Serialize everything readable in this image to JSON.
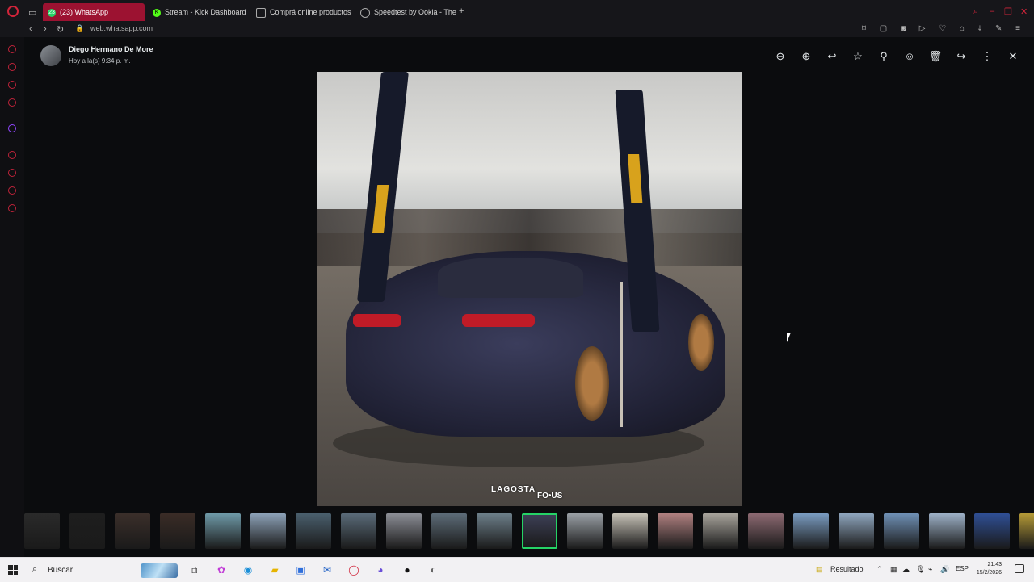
{
  "browser": {
    "tabs": [
      {
        "label": "(23) WhatsApp",
        "badge": "23",
        "active": true
      },
      {
        "label": "Stream - Kick Dashboard",
        "active": false
      },
      {
        "label": "Comprá online productos",
        "active": false
      },
      {
        "label": "Speedtest by Ookla - The",
        "active": false
      }
    ],
    "url": "web.whatsapp.com",
    "accent": "#d0243a"
  },
  "viewer": {
    "contact_name": "Diego Hermano De More",
    "timestamp": "Hoy a la(s) 9:34 p. m.",
    "toolbar": [
      "zoom-out-icon",
      "zoom-in-icon",
      "reply-icon",
      "star-icon",
      "pin-icon",
      "emoji-icon",
      "delete-icon",
      "forward-icon",
      "more-icon",
      "close-icon"
    ],
    "watermark": "LAGOSTA",
    "watermark2": "FO•US"
  },
  "thumbnails": {
    "count": 23,
    "selected_index": 11
  },
  "taskbar": {
    "search_label": "Buscar",
    "widget_label": "Resultado",
    "lang": "ESP",
    "time": "21:43",
    "date": "15/2/2026"
  }
}
